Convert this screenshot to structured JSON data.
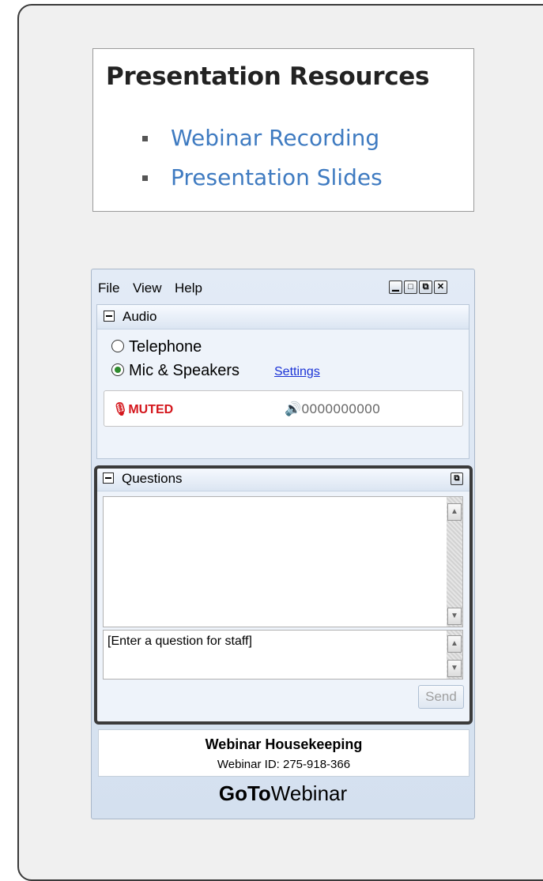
{
  "resources": {
    "title": "Presentation Resources",
    "links": [
      "Webinar Recording",
      "Presentation Slides"
    ]
  },
  "window": {
    "menu": [
      "File",
      "View",
      "Help"
    ],
    "controls": [
      "minimize",
      "maximize",
      "restore",
      "close"
    ]
  },
  "audio": {
    "title": "Audio",
    "option_telephone": "Telephone",
    "option_mic": "Mic & Speakers",
    "selected": "Mic & Speakers",
    "settings_link": "Settings",
    "muted_label": "MUTED",
    "volume_meter": "0000000000"
  },
  "questions": {
    "title": "Questions",
    "input_placeholder": "[Enter a question for staff]",
    "send_label": "Send"
  },
  "housekeeping": {
    "title": "Webinar Housekeeping",
    "webinar_id": "Webinar ID: 275-918-366"
  },
  "brand": {
    "goto": "GoTo",
    "webinar": "Webinar"
  },
  "colors": {
    "link_blue": "#3f7bc1",
    "muted_red": "#d4161c",
    "settings_link": "#1a32d6"
  }
}
